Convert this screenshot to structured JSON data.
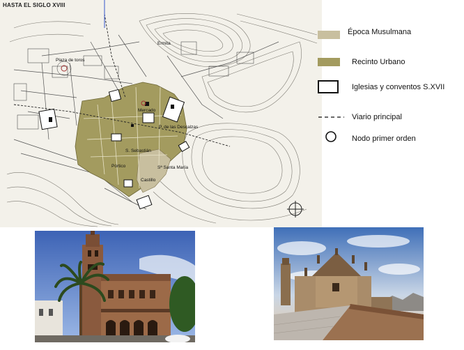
{
  "map": {
    "title": "HASTA EL SIGLO XVIII",
    "labels": {
      "plaza_toros": "Plaza de toros",
      "ermita": "Ermita",
      "mercado": "Mercado",
      "descalzas": "P. de las Descalzas",
      "san_sebastian": "S. Sebastián",
      "portico": "Pórtico",
      "santa_maria": "Sª Santa María",
      "castillo": "Castillo"
    }
  },
  "legend": {
    "items": [
      {
        "label": "Época Musulmana",
        "color": "#c8bf9f",
        "symbol": "filled-box"
      },
      {
        "label": "Recinto Urbano",
        "color": "#a39b5f",
        "symbol": "filled-box"
      },
      {
        "label": "Iglesias y conventos S.XVII",
        "color": "#ffffff",
        "symbol": "outlined-box"
      },
      {
        "label": "Viario principal",
        "symbol": "dashed-line"
      },
      {
        "label": "Nodo primer orden",
        "symbol": "circle"
      }
    ]
  },
  "photos": [
    {
      "subject": "church-tower-plaza-photo"
    },
    {
      "subject": "church-dome-terrace-photo"
    }
  ]
}
